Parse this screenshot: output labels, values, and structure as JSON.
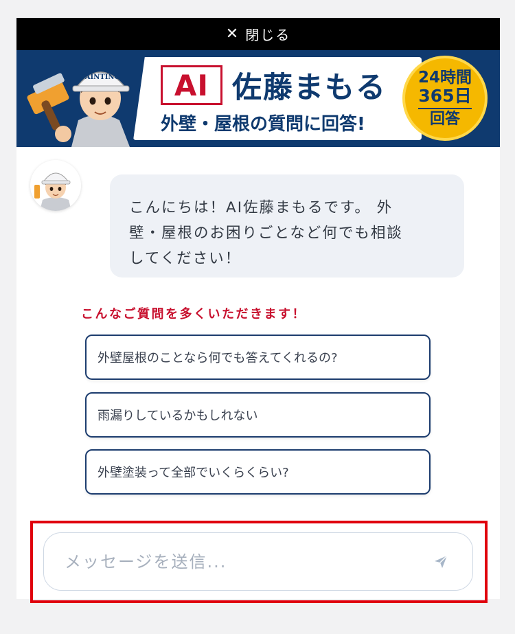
{
  "close_bar": {
    "icon": "close-icon",
    "label": "閉じる"
  },
  "banner": {
    "ai_label": "AI",
    "name": "佐藤まもる",
    "subtitle": "外壁・屋根の質問に回答!",
    "badge_line1": "24時間",
    "badge_line2": "365日",
    "badge_line3": "回答",
    "helmet_text": "PAINTING",
    "brand_color": "#0f3a6f",
    "accent_color": "#c8102e",
    "badge_color": "#f5b800"
  },
  "chat": {
    "greeting_line1": "こんにちは！AI佐藤まもるです。 外",
    "greeting_line2": "壁・屋根のお困りごとなど何でも相談",
    "greeting_line3": "してください！"
  },
  "faq": {
    "heading": "こんなご質問を多くいただきます！",
    "items": [
      "外壁屋根のことなら何でも答えてくれるの?",
      "雨漏りしているかもしれない",
      "外壁塗装って全部でいくらくらい?"
    ]
  },
  "input": {
    "placeholder": "メッセージを送信...",
    "value": "",
    "send_icon": "send-icon",
    "highlight_color": "#e0000d"
  }
}
